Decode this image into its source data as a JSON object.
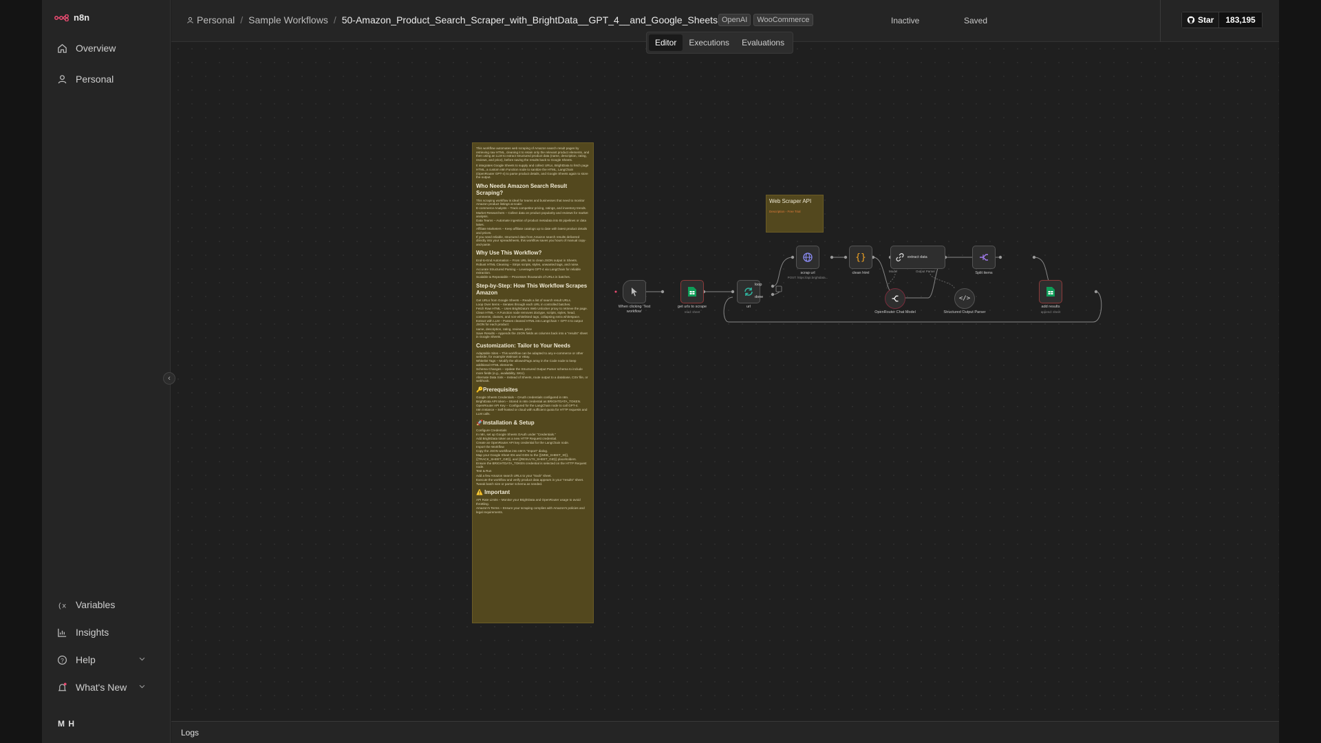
{
  "app": {
    "name": "n8n"
  },
  "sidebar": {
    "items": [
      {
        "label": "Overview",
        "icon": "home-icon"
      },
      {
        "label": "Personal",
        "icon": "user-icon"
      }
    ],
    "bottom_items": [
      {
        "label": "Variables",
        "icon": "variables-icon"
      },
      {
        "label": "Insights",
        "icon": "insights-icon"
      },
      {
        "label": "Help",
        "icon": "help-icon"
      },
      {
        "label": "What's New",
        "icon": "bell-icon"
      }
    ],
    "user_initials": "M H"
  },
  "header": {
    "breadcrumb": [
      "Personal",
      "Sample Workflows"
    ],
    "workflow_name": "50-Amazon_Product_Search_Scraper_with_BrightData__GPT_4__and_Google_Sheets",
    "tags": [
      "OpenAI",
      "WooCommerce"
    ],
    "status": "Inactive",
    "save_state": "Saved",
    "github": {
      "label": "Star",
      "count": "183,195"
    }
  },
  "view_tabs": [
    {
      "label": "Editor",
      "active": true
    },
    {
      "label": "Executions",
      "active": false
    },
    {
      "label": "Evaluations",
      "active": false
    }
  ],
  "logs_label": "Logs",
  "sticky_note": {
    "intro": [
      "This workflow automates web scraping of Amazon search result pages by retrieving raw HTML, cleaning it to retain only the relevant product elements, and then using an LLM to extract structured product data (name, description, rating, reviews, and price), before saving the results back to Google Sheets.",
      "It integrates Google Sheets to supply and collect URLs, BrightData to fetch page HTML, a custom n8n Function node to sanitize the HTML, LangChain (OpenRouter GPT-4) to parse product details, and Google Sheets again to store the output."
    ],
    "sections": [
      {
        "heading": "Who Needs Amazon Search Result Scraping?",
        "lines": [
          "This scraping workflow is ideal for teams and businesses that need to monitor Amazon product listings at scale:",
          "E-commerce Analysts – Track competitor pricing, ratings, and inventory trends.",
          "Market Researchers – Collect data on product popularity and reviews for market analysis.",
          "Data Teams – Automate ingestion of product metadata into BI pipelines or data lakes.",
          "Affiliate Marketers – Keep affiliate catalogs up to date with latest product details and prices.",
          "If you need reliable, structured data from Amazon search results delivered directly into your spreadsheets, this workflow saves you hours of manual copy-and-paste."
        ]
      },
      {
        "heading": "Why Use This Workflow?",
        "lines": [
          "End-to-End Automation – From URL list to clean JSON output in Sheets.",
          "Robust HTML Cleaning – Strips scripts, styles, unwanted tags, and noise.",
          "Accurate Structured Parsing – Leverages GPT-4 via LangChain for reliable extraction.",
          "Scalable & Repeatable – Processes thousands of URLs in batches."
        ]
      },
      {
        "heading": "Step-by-Step: How This Workflow Scrapes Amazon",
        "lines": [
          "Get URLs from Google Sheets – Reads a list of search result URLs.",
          "Loop Over Items – Iterates through each URL in controlled batches.",
          "Fetch Raw HTML – Uses BrightData's Web Unlocker proxy to retrieve the page.",
          "Clean HTML – A Function node removes doctype, scripts, styles, head, comments, classes, and non-whitelisted tags, collapsing extra whitespace.",
          "Extract with LLM – Passes cleaned HTML into LangChain + GPT-4 to output JSON for each product:",
          "name, description, rating, reviews, price",
          "Save Results – Appends the JSON fields as columns back into a \"results\" sheet in Google Sheets."
        ]
      },
      {
        "heading": "Customization: Tailor to Your Needs",
        "lines": [
          "Adaptable Sites – This workflow can be adapted to any e-commerce or other website, for example Walmart or eBay.",
          "Whitelist Tags – Modify the allowedTags array in the Code node to keep additional HTML elements.",
          "Schema Changes – Update the Structured Output Parser schema to include more fields (e.g., availability, SKU).",
          "Alternate Data Sink – Instead of Sheets, route output to a database, CSV file, or webhook."
        ]
      },
      {
        "heading": "🔑Prerequisites",
        "lines": [
          "Google Sheets Credentials – OAuth credentials configured in n8n.",
          "BrightData API token – Stored in n8n credential as BRIGHTDATA_TOKEN.",
          "OpenRouter API Key – Configured for the LangChain node to call GPT-4.",
          "n8n Instance – Self-hosted or cloud with sufficient quota for HTTP requests and LLM calls."
        ]
      },
      {
        "heading": "🚀Installation & Setup",
        "lines": [
          "Configure Credentials",
          "In n8n, set up Google Sheets OAuth under \"Credentials.\"",
          "Add BrightData token as a new HTTP Request credential.",
          "Create an OpenRouter API key credential for the LangChain node.",
          "Import the Workflow",
          "Copy the JSON workflow into n8n's \"Import\" dialog.",
          "Map your Google Sheet IDs and GIDs to the {{WEB_SHEET_ID}}, {{TRACK_SHEET_GID}}, and {{RESULTS_SHEET_GID}} placeholders.",
          "Ensure the BRIGHTDATA_TOKEN credential is selected on the HTTP Request node.",
          "Test & Run",
          "Add a few Amazon search URLs to your \"track\" sheet.",
          "Execute the workflow and verify product data appears in your \"results\" sheet.",
          "Tweak batch size or parser schema as needed."
        ]
      },
      {
        "heading": "⚠️ Important",
        "lines": [
          "API Rate Limits – Monitor your BrightData and OpenRouter usage to avoid throttling.",
          "Amazon's Terms – Ensure your scraping complies with Amazon's policies and legal requirements."
        ]
      }
    ]
  },
  "sticky_small": {
    "title": "Web Scraper API",
    "subtitle": "Description - Free Trial"
  },
  "nodes": [
    {
      "label": "When clicking 'Test workflow'",
      "sub": ""
    },
    {
      "label": "get urls to scrape",
      "sub": "read: sheet"
    },
    {
      "label": "url",
      "sub": ""
    },
    {
      "label": "scrap url",
      "sub": "POST: https://api.brightdata..."
    },
    {
      "label": "clean html",
      "sub": ""
    },
    {
      "label": "extract data",
      "sub": ""
    },
    {
      "label": "Split items",
      "sub": ""
    },
    {
      "label": "add results",
      "sub": "append: sheet"
    },
    {
      "label": "OpenRouter Chat Model",
      "sub": ""
    },
    {
      "label": "Structured Output Parser",
      "sub": ""
    }
  ],
  "ports": {
    "model": "Model",
    "output_parser": "Output Parser",
    "loop": "loop",
    "done": "done"
  },
  "colors": {
    "accent": "#ea4b71",
    "sheets": "#0f9d58",
    "sticky": "#53481e"
  }
}
